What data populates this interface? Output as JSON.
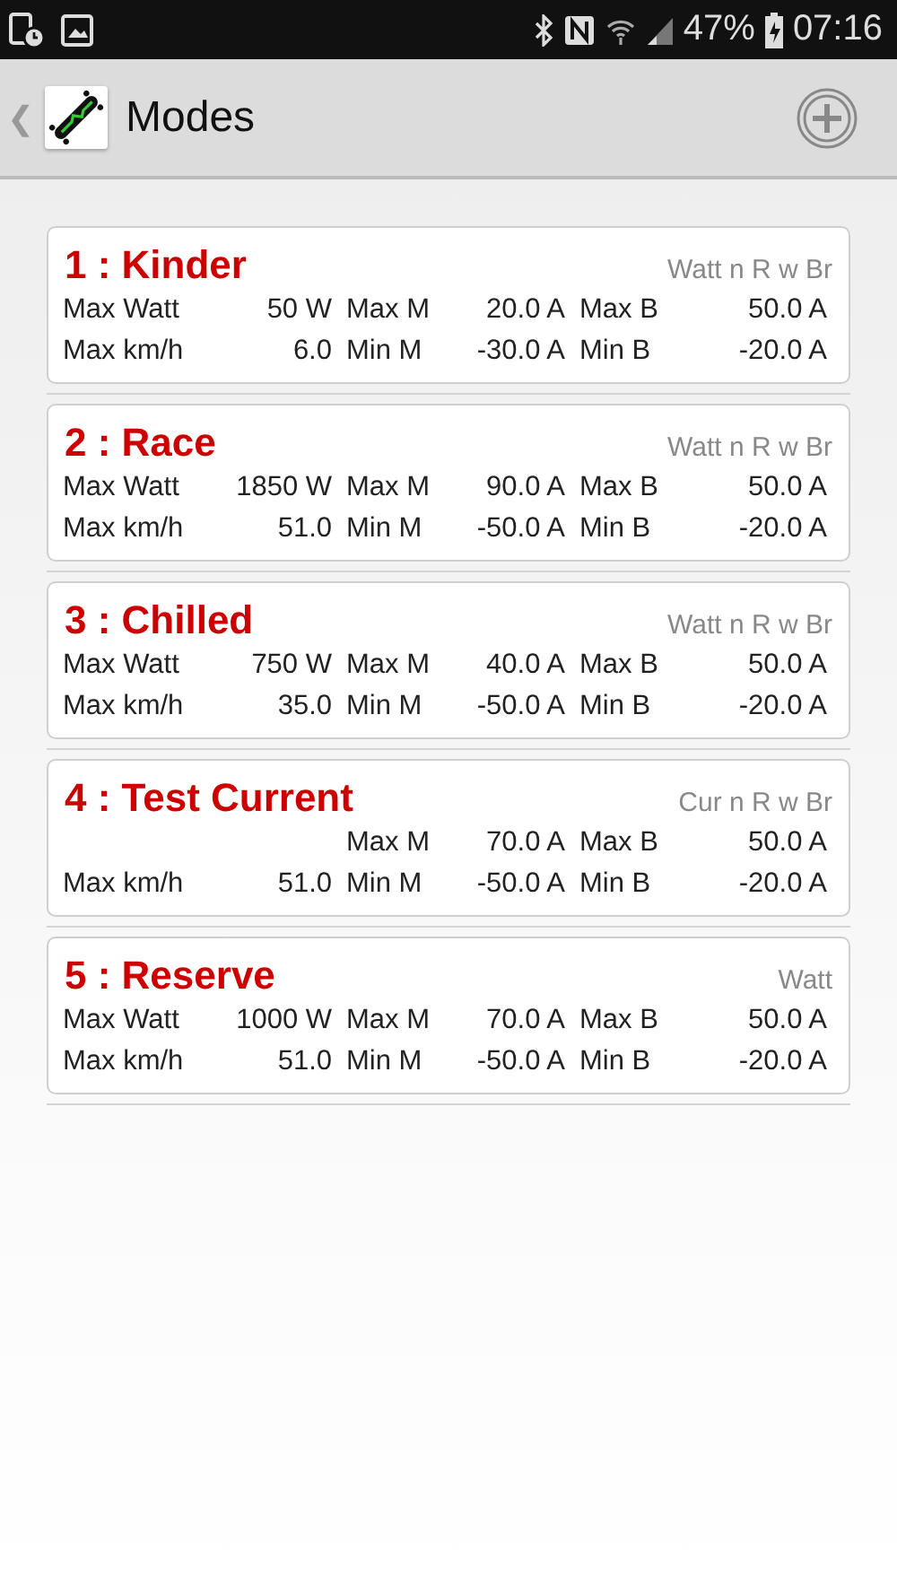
{
  "status_bar": {
    "battery": "47%",
    "time": "07:16"
  },
  "header": {
    "back": "❮",
    "title": "Modes"
  },
  "modes": [
    {
      "title": "1 : Kinder",
      "type": "Watt n R w Br",
      "rows": [
        {
          "left": {
            "label": "Max Watt",
            "value": "50 W"
          },
          "mid": {
            "label": "Max M",
            "value": "20.0 A"
          },
          "right": {
            "label": "Max B",
            "value": "50.0 A"
          }
        },
        {
          "left": {
            "label": "Max km/h",
            "value": "6.0"
          },
          "mid": {
            "label": "Min M",
            "value": "-30.0 A"
          },
          "right": {
            "label": "Min B",
            "value": "-20.0 A"
          }
        }
      ]
    },
    {
      "title": "2 : Race",
      "type": "Watt n R w Br",
      "rows": [
        {
          "left": {
            "label": "Max Watt",
            "value": "1850 W"
          },
          "mid": {
            "label": "Max M",
            "value": "90.0 A"
          },
          "right": {
            "label": "Max B",
            "value": "50.0 A"
          }
        },
        {
          "left": {
            "label": "Max km/h",
            "value": "51.0"
          },
          "mid": {
            "label": "Min M",
            "value": "-50.0 A"
          },
          "right": {
            "label": "Min B",
            "value": "-20.0 A"
          }
        }
      ]
    },
    {
      "title": "3 : Chilled",
      "type": "Watt n R w Br",
      "rows": [
        {
          "left": {
            "label": "Max Watt",
            "value": "750 W"
          },
          "mid": {
            "label": "Max M",
            "value": "40.0 A"
          },
          "right": {
            "label": "Max B",
            "value": "50.0 A"
          }
        },
        {
          "left": {
            "label": "Max km/h",
            "value": "35.0"
          },
          "mid": {
            "label": "Min M",
            "value": "-50.0 A"
          },
          "right": {
            "label": "Min B",
            "value": "-20.0 A"
          }
        }
      ]
    },
    {
      "title": "4 : Test Current",
      "type": "Cur n R w Br",
      "rows": [
        {
          "mid": {
            "label": "Max M",
            "value": "70.0 A"
          },
          "right": {
            "label": "Max B",
            "value": "50.0 A"
          }
        },
        {
          "left": {
            "label": "Max km/h",
            "value": "51.0"
          },
          "mid": {
            "label": "Min M",
            "value": "-50.0 A"
          },
          "right": {
            "label": "Min B",
            "value": "-20.0 A"
          }
        }
      ]
    },
    {
      "title": "5 : Reserve",
      "type": "Watt",
      "rows": [
        {
          "left": {
            "label": "Max Watt",
            "value": "1000 W"
          },
          "mid": {
            "label": "Max M",
            "value": "70.0 A"
          },
          "right": {
            "label": "Max B",
            "value": "50.0 A"
          }
        },
        {
          "left": {
            "label": "Max km/h",
            "value": "51.0"
          },
          "mid": {
            "label": "Min M",
            "value": "-50.0 A"
          },
          "right": {
            "label": "Min B",
            "value": "-20.0 A"
          }
        }
      ]
    }
  ]
}
